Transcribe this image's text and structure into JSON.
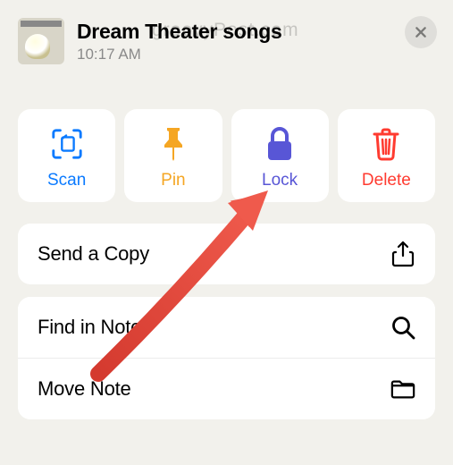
{
  "header": {
    "title": "Dream Theater songs",
    "time": "10:17 AM",
    "watermark": "groovyPost.com"
  },
  "actions": {
    "scan": {
      "label": "Scan"
    },
    "pin": {
      "label": "Pin"
    },
    "lock": {
      "label": "Lock"
    },
    "delete": {
      "label": "Delete"
    }
  },
  "menu": {
    "sendCopy": {
      "label": "Send a Copy"
    },
    "findInNote": {
      "label": "Find in Note"
    },
    "moveNote": {
      "label": "Move Note"
    }
  },
  "colors": {
    "blue": "#0a7aff",
    "orange": "#f5a623",
    "purple": "#5856d6",
    "red": "#ff3b30"
  }
}
